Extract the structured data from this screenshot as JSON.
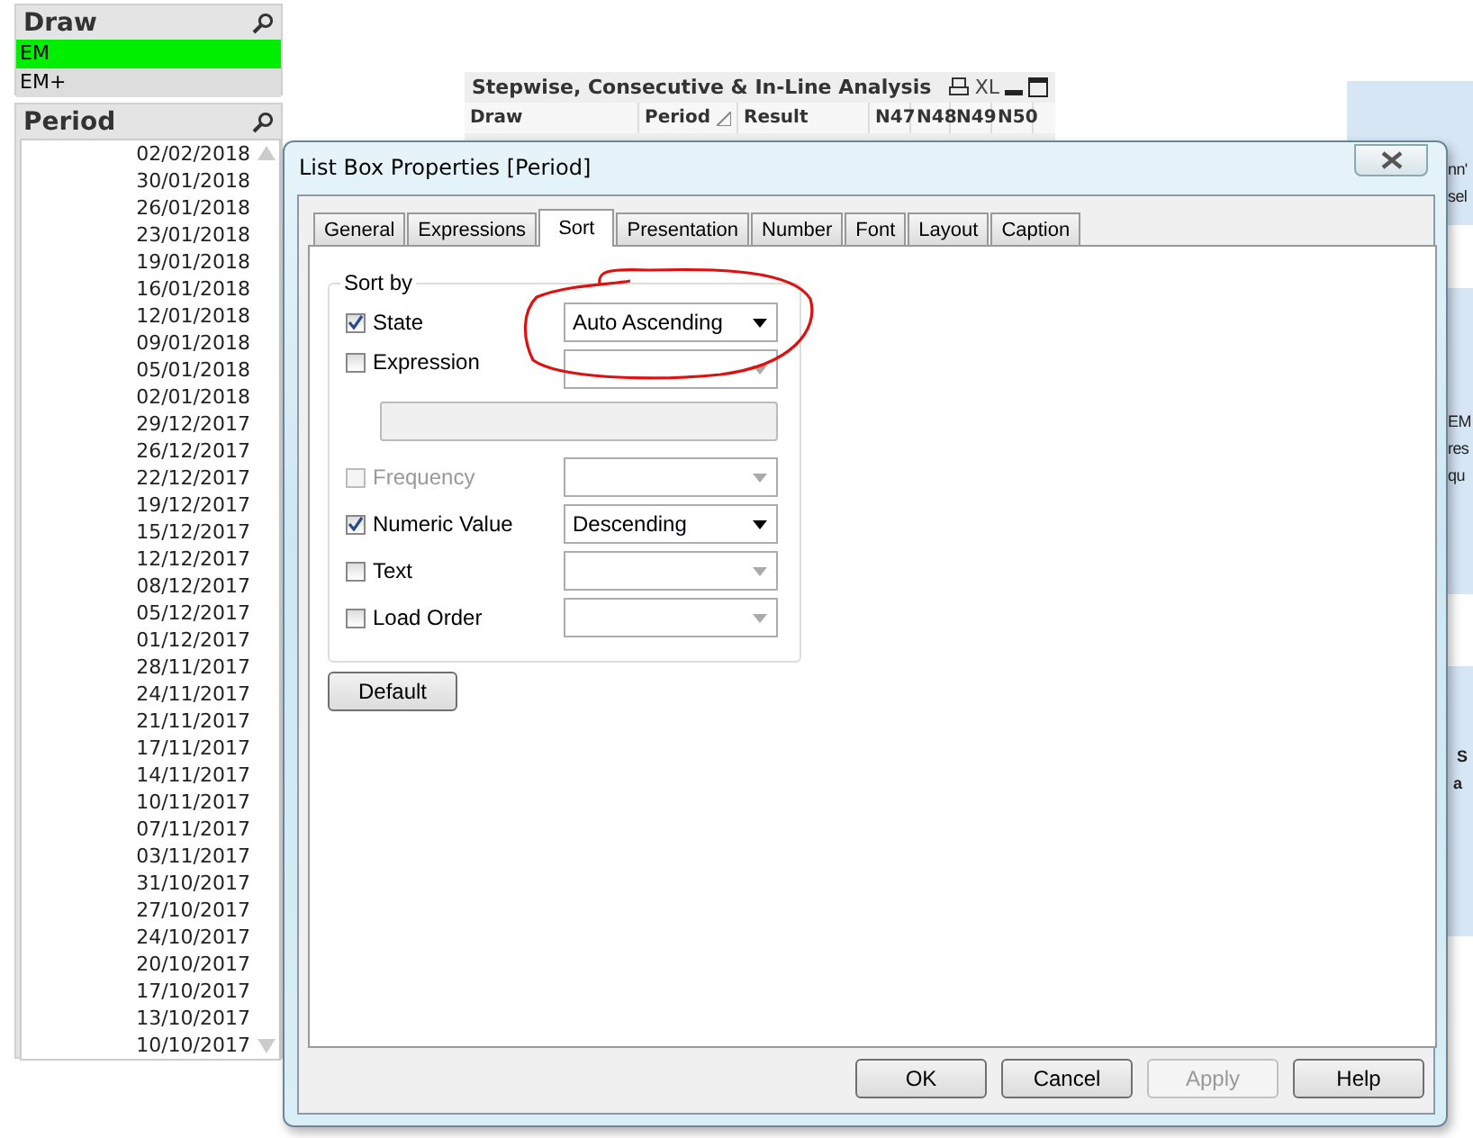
{
  "draw_listbox": {
    "title": "Draw",
    "items": [
      {
        "label": "EM",
        "selected": true
      },
      {
        "label": "EM+",
        "selected": false
      }
    ]
  },
  "period_listbox": {
    "title": "Period",
    "items": [
      "02/02/2018",
      "30/01/2018",
      "26/01/2018",
      "23/01/2018",
      "19/01/2018",
      "16/01/2018",
      "12/01/2018",
      "09/01/2018",
      "05/01/2018",
      "02/01/2018",
      "29/12/2017",
      "26/12/2017",
      "22/12/2017",
      "19/12/2017",
      "15/12/2017",
      "12/12/2017",
      "08/12/2017",
      "05/12/2017",
      "01/12/2017",
      "28/11/2017",
      "24/11/2017",
      "21/11/2017",
      "17/11/2017",
      "14/11/2017",
      "10/11/2017",
      "07/11/2017",
      "03/11/2017",
      "31/10/2017",
      "27/10/2017",
      "24/10/2017",
      "20/10/2017",
      "17/10/2017",
      "13/10/2017",
      "10/10/2017"
    ]
  },
  "analysis_table": {
    "title": "Stepwise, Consecutive & In-Line Analysis",
    "export_label": "XL",
    "columns": [
      "Draw",
      "Period",
      "Result",
      "N47",
      "N48",
      "N49",
      "N50"
    ]
  },
  "side_panels": [
    {
      "lines": [
        "nn'",
        "sel"
      ]
    },
    {
      "lines": [
        "EM",
        "res",
        "qu"
      ]
    },
    {
      "lines": [
        "S",
        "a"
      ]
    }
  ],
  "dialog": {
    "title": "List Box Properties [Period]",
    "tabs": [
      {
        "label": "General",
        "selected": false
      },
      {
        "label": "Expressions",
        "selected": false
      },
      {
        "label": "Sort",
        "selected": true
      },
      {
        "label": "Presentation",
        "selected": false
      },
      {
        "label": "Number",
        "selected": false
      },
      {
        "label": "Font",
        "selected": false
      },
      {
        "label": "Layout",
        "selected": false
      },
      {
        "label": "Caption",
        "selected": false
      }
    ],
    "group_title": "Sort by",
    "options": [
      {
        "kind": "plain",
        "label": "State",
        "checked": true,
        "disabled": false,
        "value": "Auto Ascending"
      },
      {
        "kind": "expression",
        "label": "Expression",
        "checked": false,
        "disabled": false
      },
      {
        "kind": "plain",
        "label": "Frequency",
        "checked": false,
        "disabled": true
      },
      {
        "kind": "plain",
        "label": "Numeric Value",
        "checked": true,
        "disabled": false,
        "value": "Descending"
      },
      {
        "kind": "plain",
        "label": "Text",
        "checked": false,
        "disabled": false
      },
      {
        "kind": "plain",
        "label": "Load Order",
        "checked": false,
        "disabled": false
      }
    ],
    "default_button": "Default",
    "buttons": [
      {
        "label": "OK",
        "disabled": false
      },
      {
        "label": "Cancel",
        "disabled": false
      },
      {
        "label": "Apply",
        "disabled": true
      },
      {
        "label": "Help",
        "disabled": false
      }
    ]
  }
}
